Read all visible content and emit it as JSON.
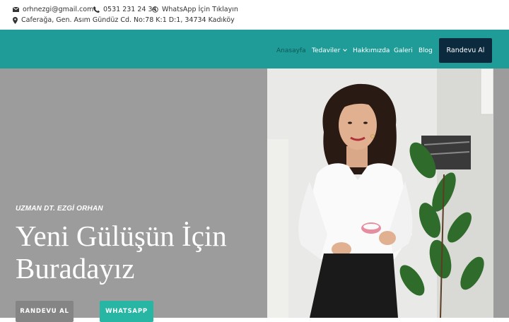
{
  "topbar": {
    "email": "orhnezgi@gmail.com",
    "phone": "0531 231 24 34",
    "whatsapp": "WhatsApp İçin Tıklayın",
    "address": "Caferağa, Gen. Asım Gündüz Cd. No:78 K:1 D:1, 34734 Kadıköy"
  },
  "nav": {
    "items": [
      {
        "label": "Anasayfa",
        "icon": null
      },
      {
        "label": "Tedaviler",
        "icon": "chevron-down-icon"
      },
      {
        "label": "Hakkımızda",
        "icon": null
      },
      {
        "label": "Galeri",
        "icon": null
      },
      {
        "label": "Blog",
        "icon": null
      }
    ],
    "cta": "Randevu Al"
  },
  "hero": {
    "subtitle": "UZMAN DT. EZGİ ORHAN",
    "headline": "Yeni Gülüşün İçin Buradayız",
    "btn_appointment": "RANDEVU AL",
    "btn_whatsapp": "WHATSAPP"
  },
  "colors": {
    "nav_bg": "#1f9c98",
    "cta_bg": "#0c2a3e",
    "whatsapp_btn": "#27b5a4",
    "hero_bg": "#9c9c9c"
  }
}
